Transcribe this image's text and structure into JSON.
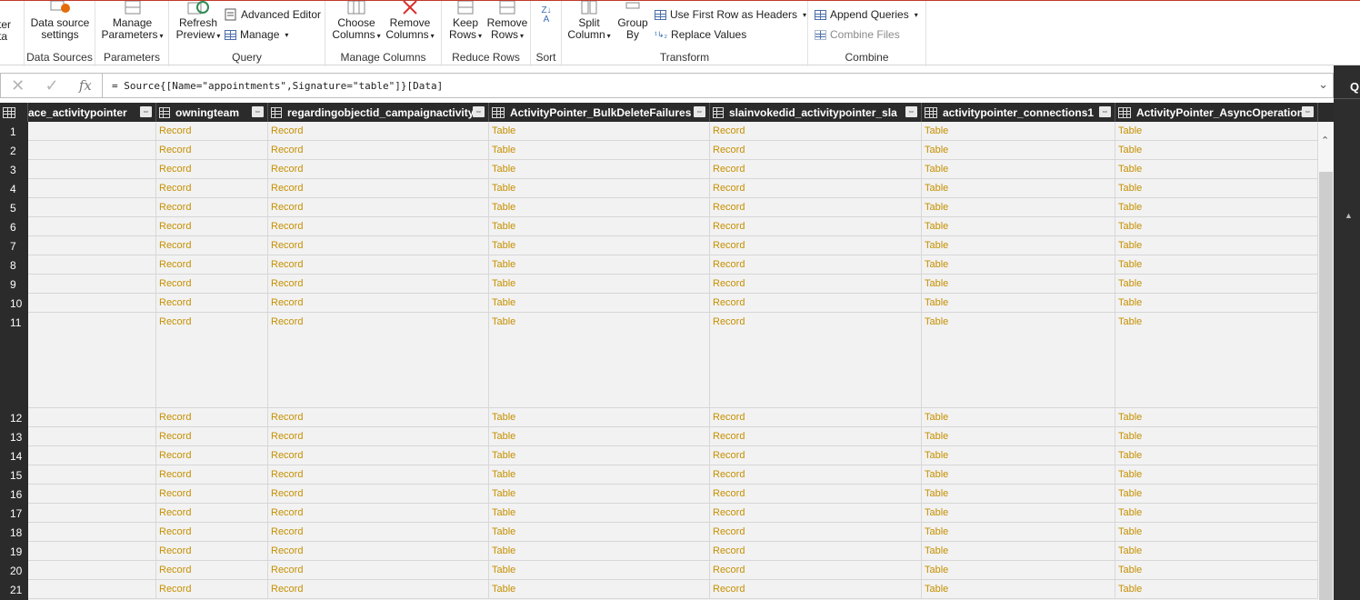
{
  "ribbon": {
    "groups": [
      {
        "label": "Data Sources",
        "buttons": [
          "Data source settings"
        ]
      },
      {
        "label": "Parameters",
        "buttons": [
          "Manage Parameters"
        ]
      },
      {
        "label": "Query",
        "buttons": [
          "Refresh Preview",
          "Advanced Editor",
          "Manage"
        ]
      },
      {
        "label": "Manage Columns",
        "buttons": [
          "Choose Columns",
          "Remove Columns"
        ]
      },
      {
        "label": "Reduce Rows",
        "buttons": [
          "Keep Rows",
          "Remove Rows"
        ]
      },
      {
        "label": "Sort",
        "buttons": []
      },
      {
        "label": "Transform",
        "buttons": [
          "Split Column",
          "Group By",
          "Use First Row as Headers",
          "Replace Values"
        ]
      },
      {
        "label": "Combine",
        "buttons": [
          "Append Queries",
          "Combine Files"
        ]
      }
    ],
    "partial_left": {
      "line1": "ter",
      "line2": "ta"
    },
    "data_source_settings": {
      "line1": "Data source",
      "line2": "settings"
    },
    "manage_parameters": {
      "line1": "Manage",
      "line2": "Parameters"
    },
    "refresh_preview": {
      "line1": "Refresh",
      "line2": "Preview"
    },
    "advanced_editor": "Advanced Editor",
    "manage": "Manage",
    "choose_columns": {
      "line1": "Choose",
      "line2": "Columns"
    },
    "remove_columns": {
      "line1": "Remove",
      "line2": "Columns"
    },
    "keep_rows": {
      "line1": "Keep",
      "line2": "Rows"
    },
    "remove_rows": {
      "line1": "Remove",
      "line2": "Rows"
    },
    "split_column": {
      "line1": "Split",
      "line2": "Column"
    },
    "group_by": {
      "line1": "Group",
      "line2": "By"
    },
    "use_first_row": "Use First Row as Headers",
    "replace_values": "Replace Values",
    "append_queries": "Append Queries",
    "combine_files": "Combine Files"
  },
  "formula_bar": {
    "formula": "= Source{[Name=\"appointments\",Signature=\"table\"]}[Data]",
    "fx": "fx"
  },
  "right_panel": {
    "initial": "Q"
  },
  "grid": {
    "columns": [
      {
        "name": "ace_activitypointer",
        "type": "none"
      },
      {
        "name": "owningteam",
        "type": "record"
      },
      {
        "name": "regardingobjectid_campaignactivity",
        "type": "record"
      },
      {
        "name": "ActivityPointer_BulkDeleteFailures",
        "type": "table"
      },
      {
        "name": "slainvokedid_activitypointer_sla",
        "type": "record"
      },
      {
        "name": "activitypointer_connections1",
        "type": "table"
      },
      {
        "name": "ActivityPointer_AsyncOperations",
        "type": "table"
      }
    ],
    "row_numbers": [
      "1",
      "2",
      "3",
      "4",
      "5",
      "6",
      "7",
      "8",
      "9",
      "10",
      "11",
      "12",
      "13",
      "14",
      "15",
      "16",
      "17",
      "18",
      "19",
      "20",
      "21"
    ],
    "cell_values": [
      "",
      "Record",
      "Record",
      "Table",
      "Record",
      "Table",
      "Table"
    ]
  }
}
